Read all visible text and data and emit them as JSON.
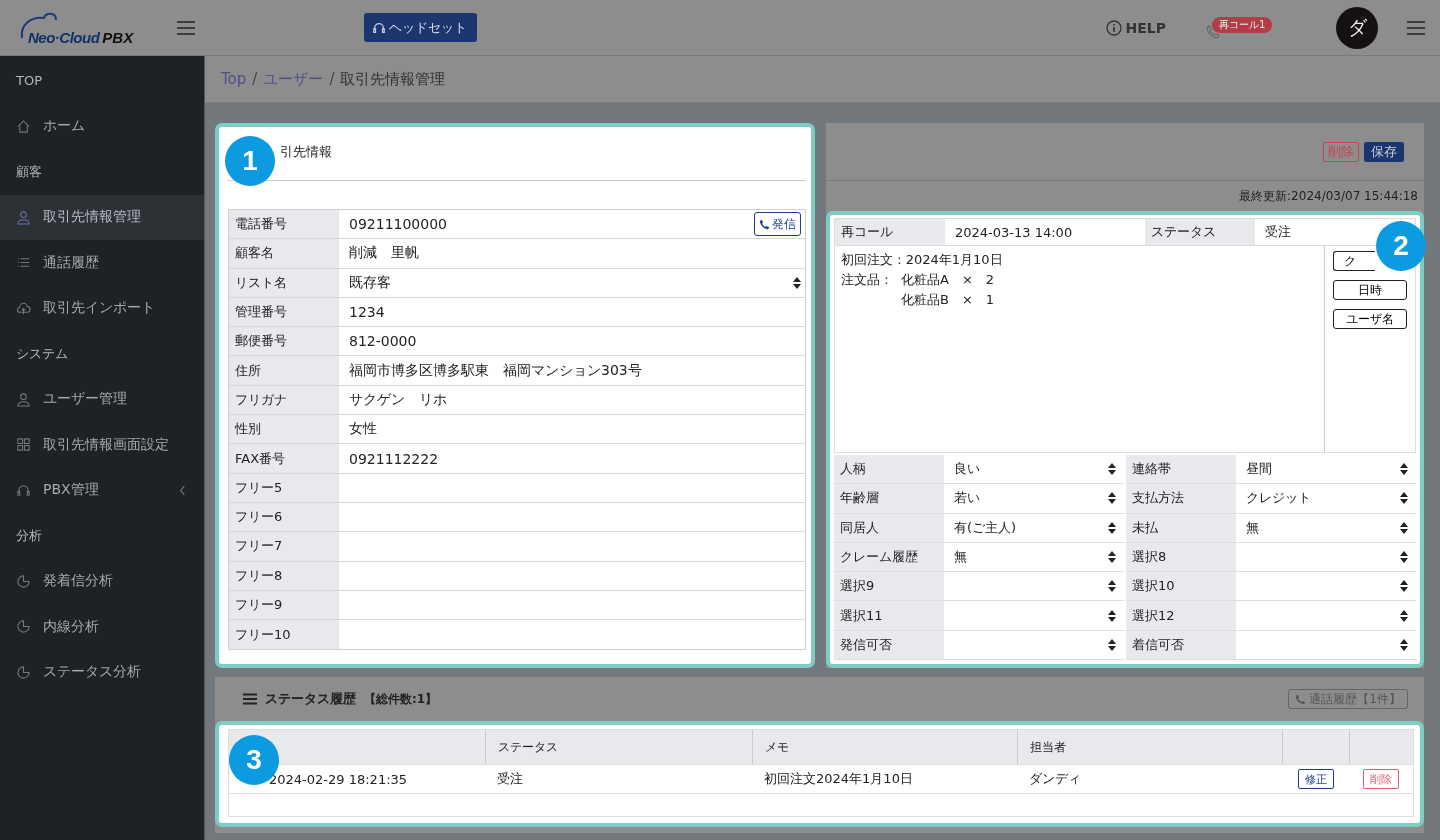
{
  "header": {
    "logo": {
      "name": "Neo·Cloud",
      "suffix": "PBX"
    },
    "headset_button": "ヘッドセット",
    "help": "HELP",
    "recall_badge": "再コール1",
    "avatar": "ダ"
  },
  "sidebar": [
    {
      "heading": "TOP",
      "items": [
        {
          "label": "ホーム",
          "selected": false,
          "kind": "link"
        }
      ]
    },
    {
      "heading": "顧客",
      "items": [
        {
          "label": "取引先情報管理",
          "selected": true,
          "kind": "link"
        },
        {
          "label": "通話履歴",
          "selected": false,
          "kind": "link"
        },
        {
          "label": "取引先インポート",
          "selected": false,
          "kind": "link"
        }
      ]
    },
    {
      "heading": "システム",
      "items": [
        {
          "label": "ユーザー管理",
          "selected": false,
          "kind": "link"
        },
        {
          "label": "取引先情報画面設定",
          "selected": false,
          "kind": "link"
        },
        {
          "label": "PBX管理",
          "selected": false,
          "kind": "group"
        }
      ]
    },
    {
      "heading": "分析",
      "items": [
        {
          "label": "発着信分析",
          "selected": false,
          "kind": "link"
        },
        {
          "label": "内線分析",
          "selected": false,
          "kind": "link"
        },
        {
          "label": "ステータス分析",
          "selected": false,
          "kind": "link"
        }
      ]
    }
  ],
  "breadcrumb": {
    "separator": "/",
    "items": [
      {
        "label": "Top",
        "link": true
      },
      {
        "label": "ユーザー",
        "link": true
      },
      {
        "label": "取引先情報管理",
        "link": false
      }
    ]
  },
  "customer": {
    "callout": "1",
    "title": "引先情報",
    "call_button": "発信",
    "fields": [
      {
        "label": "電話番号",
        "value": "09211100000",
        "kind": "phone"
      },
      {
        "label": "顧客名",
        "value": "削減　里帆",
        "kind": "text"
      },
      {
        "label": "リスト名",
        "value": "既存客",
        "kind": "select"
      },
      {
        "label": "管理番号",
        "value": "1234",
        "kind": "text"
      },
      {
        "label": "郵便番号",
        "value": "812-0000",
        "kind": "text"
      },
      {
        "label": "住所",
        "value": "福岡市博多区博多駅東　福岡マンション303号",
        "kind": "text"
      },
      {
        "label": "フリガナ",
        "value": "サクゲン　リホ",
        "kind": "text"
      },
      {
        "label": "性別",
        "value": "女性",
        "kind": "text"
      },
      {
        "label": "FAX番号",
        "value": "0921112222",
        "kind": "text"
      },
      {
        "label": "フリー5",
        "kind": "text"
      },
      {
        "label": "フリー6",
        "kind": "text"
      },
      {
        "label": "フリー7",
        "kind": "text"
      },
      {
        "label": "フリー8",
        "kind": "text"
      },
      {
        "label": "フリー9",
        "kind": "text"
      },
      {
        "label": "フリー10",
        "kind": "text"
      }
    ]
  },
  "actions": {
    "delete": "削除",
    "save": "保存",
    "last_updated": "最終更新:2024/03/07 15:44:18"
  },
  "detail": {
    "callout": "2",
    "recall_label": "再コール",
    "recall_value": "2024-03-13 14:00",
    "status_label": "ステータス",
    "status_value": "受注",
    "memo": {
      "first_order": "初回注文 : 2024年1月10日",
      "items_label": "注文品 :",
      "items": [
        "化粧品A　×　2",
        "化粧品B　×　1"
      ]
    },
    "memo_buttons": [
      "ク",
      "日時",
      "ユーザ名"
    ],
    "selects": [
      {
        "label": "人柄",
        "value": "良い"
      },
      {
        "label": "連絡帯",
        "value": "昼間"
      },
      {
        "label": "年齢層",
        "value": "若い"
      },
      {
        "label": "支払方法",
        "value": "クレジット"
      },
      {
        "label": "同居人",
        "value": "有(ご主人)"
      },
      {
        "label": "未払",
        "value": "無"
      },
      {
        "label": "クレーム履歴",
        "value": "無"
      },
      {
        "label": "選択8"
      },
      {
        "label": "選択9"
      },
      {
        "label": "選択10"
      },
      {
        "label": "選択11"
      },
      {
        "label": "選択12"
      },
      {
        "label": "発信可否"
      },
      {
        "label": "着信可否"
      }
    ]
  },
  "history": {
    "callout": "3",
    "title": "ステータス履歴",
    "count": "【総件数:1】",
    "call_history_button": "通話履歴【1件】",
    "columns": [
      "",
      "ステータス",
      "メモ",
      "担当者"
    ],
    "rows": [
      {
        "cells": [
          "2024-02-29 18:21:35",
          "受注",
          "初回注文2024年1月10日",
          "ダンディ"
        ],
        "edit": "修正",
        "delete": "削除"
      }
    ]
  }
}
